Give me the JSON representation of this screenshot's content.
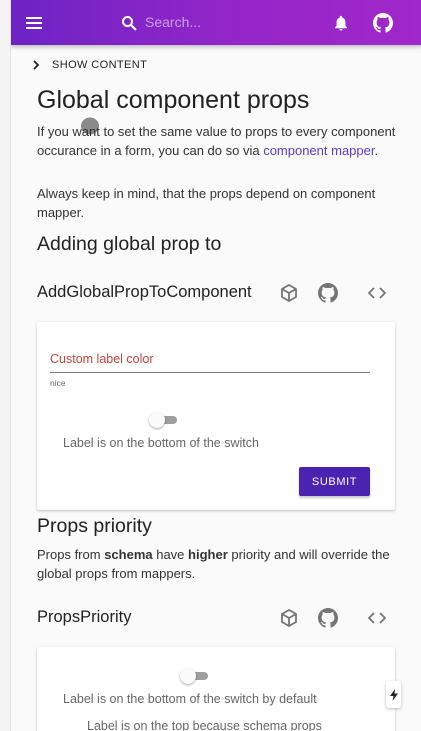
{
  "appbar": {
    "search_placeholder": "Search...",
    "icons": [
      "menu-icon",
      "search-icon",
      "bell-icon",
      "github-icon"
    ],
    "gradient": [
      "#6d23c4",
      "#a027c9"
    ]
  },
  "toc": {
    "label": "SHOW CONTENT"
  },
  "page": {
    "title": "Global component props",
    "intro_before_link": "If you want to set the same value to props to every component occurance in a form, you can do so via ",
    "intro_link": "component mapper",
    "intro_after_link": ".",
    "note": "Always keep in mind, that the props depend on component mapper."
  },
  "section1": {
    "heading": "Adding global prop to",
    "example_title": "AddGlobalPropToComponent",
    "tools": [
      "codesandbox-icon",
      "github-icon",
      "code-icon"
    ],
    "form": {
      "field_label": "Custom label color",
      "helper_text": "nice",
      "switch_label": "Label is on the bottom of the switch",
      "switch_checked": false,
      "submit_label": "SUBMIT"
    }
  },
  "section2": {
    "heading": "Props priority",
    "text_1": "Props from ",
    "text_bold_1": "schema",
    "text_2": " have ",
    "text_bold_2": "higher",
    "text_3": " priority and will override the global props from mappers.",
    "example_title": "PropsPriority",
    "form": {
      "switch_label": "Label is on the bottom of the switch by default",
      "switch_checked": false,
      "second_label": "Label is on the top because schema props"
    }
  },
  "colors": {
    "primary": "#4a23b0",
    "link": "#5b3bc8",
    "label_accent": "#c0453a"
  }
}
